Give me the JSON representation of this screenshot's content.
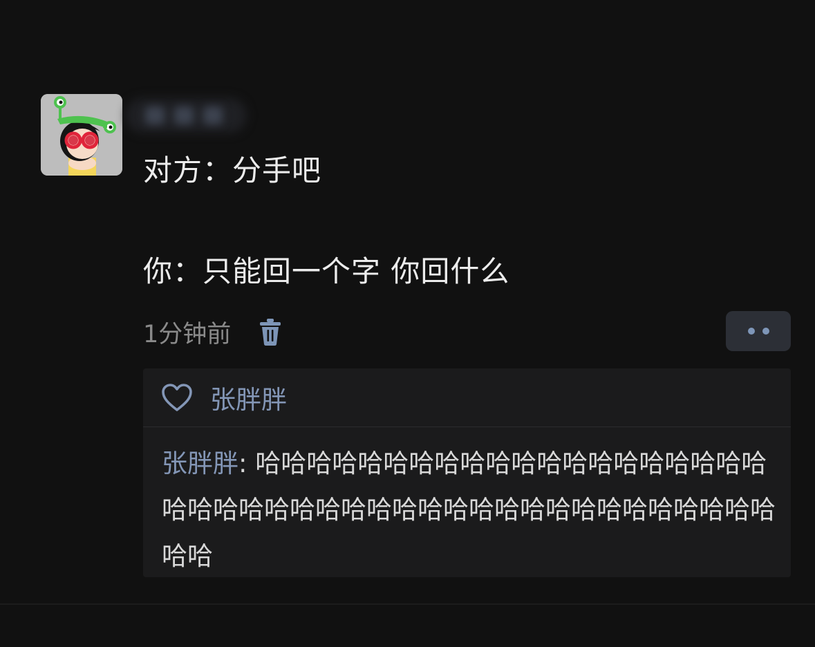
{
  "post": {
    "lines": [
      "对方：分手吧",
      "你：只能回一个字 你回什么"
    ],
    "time": "1分钟前"
  },
  "likes": {
    "names": "张胖胖"
  },
  "comment": {
    "author": "张胖胖",
    "separator": ": ",
    "text": "哈哈哈哈哈哈哈哈哈哈哈哈哈哈哈哈哈哈哈哈哈哈哈哈哈哈哈哈哈哈哈哈哈哈哈哈哈哈哈哈哈哈哈哈哈哈"
  },
  "icons": {
    "trash": "trash-icon",
    "heart": "heart-icon",
    "more": "more-dots-icon"
  },
  "colors": {
    "background": "#111111",
    "accent": "#8396b6",
    "panel": "#1b1b1c"
  }
}
